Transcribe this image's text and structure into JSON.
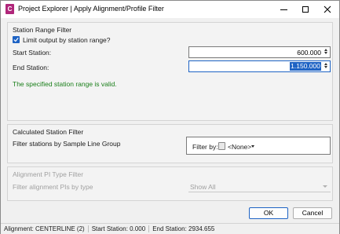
{
  "window": {
    "app_icon_letter": "C",
    "title": "Project Explorer | Apply Alignment/Profile Filter"
  },
  "station_range": {
    "legend": "Station Range Filter",
    "limit_checkbox_label": "Limit output by station range?",
    "limit_checked": true,
    "start_label": "Start Station:",
    "start_value": "600.000",
    "end_label": "End Station:",
    "end_value": "1.150.000",
    "validation_message": "The specified station range is valid."
  },
  "calculated": {
    "legend": "Calculated Station Filter",
    "description": "Filter stations by Sample Line Group",
    "filter_by_label": "Filter by:",
    "filter_by_value": "<None>"
  },
  "pi_type": {
    "legend": "Alignment PI Type Filter",
    "description": "Filter alignment PIs by type",
    "select_value": "Show All"
  },
  "buttons": {
    "ok": "OK",
    "cancel": "Cancel"
  },
  "status_bar": {
    "alignment": "Alignment: CENTERLINE (2)",
    "start_station": "Start Station: 0.000",
    "end_station": "End Station: 2934.655"
  },
  "colors": {
    "accent": "#1e63c4",
    "valid_text": "#1a7f1a",
    "app_icon": "#b0267a"
  }
}
